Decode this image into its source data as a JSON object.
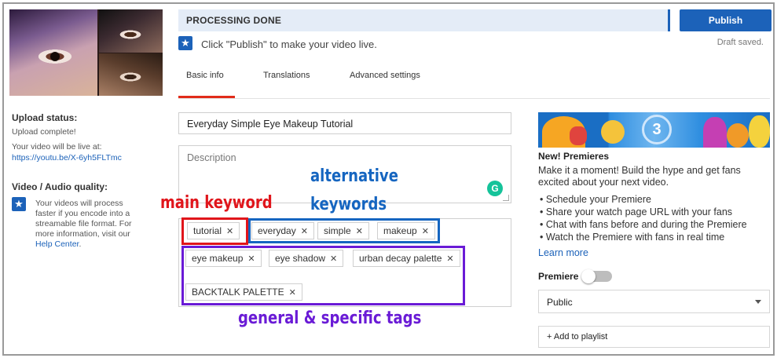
{
  "status": {
    "text": "PROCESSING DONE"
  },
  "header": {
    "publish_label": "Publish",
    "draft_text": "Draft saved.",
    "publish_hint": "Click \"Publish\" to make your video live."
  },
  "tabs": [
    {
      "label": "Basic info",
      "active": true
    },
    {
      "label": "Translations",
      "active": false
    },
    {
      "label": "Advanced settings",
      "active": false
    }
  ],
  "upload": {
    "heading": "Upload status:",
    "complete": "Upload complete!",
    "live_at": "Your video will be live at:",
    "url": "https://youtu.be/X-6yh5FLTmc"
  },
  "quality": {
    "heading": "Video / Audio quality:",
    "text": "Your videos will process faster if you encode into a streamable file format. For more information, visit our",
    "link": "Help Center",
    "end": "."
  },
  "form": {
    "title_value": "Everyday Simple Eye Makeup Tutorial",
    "description_placeholder": "Description"
  },
  "tags": [
    "tutorial",
    "everyday",
    "simple",
    "makeup",
    "eye makeup",
    "eye shadow",
    "urban decay palette",
    "BACKTALK PALETTE"
  ],
  "annotations": {
    "main": "main keyword",
    "alternative_line1": "alternative",
    "alternative_line2": "keywords",
    "general": "general & specific tags",
    "colors": {
      "main": "#e0151b",
      "alternative": "#1565c0",
      "general": "#6a1bd6"
    }
  },
  "premieres": {
    "banner_number": "3",
    "title": "New! Premieres",
    "text": "Make it a moment! Build the hype and get fans excited about your next video.",
    "bullets": [
      "Schedule your Premiere",
      "Share your watch page URL with your fans",
      "Chat with fans before and during the Premiere",
      "Watch the Premiere with fans in real time"
    ],
    "learn_more": "Learn more"
  },
  "premiere_toggle": {
    "label": "Premiere",
    "on": false
  },
  "visibility": {
    "selected": "Public"
  },
  "playlist": {
    "label": "+ Add to playlist"
  },
  "icons": {
    "star": "star-icon",
    "grammarly": "grammarly-icon",
    "remove": "close-icon",
    "caret": "caret-down-icon"
  },
  "colors": {
    "accent": "#1c62b9",
    "tab_active": "#e12b1a",
    "status_bg": "#e4ecf7"
  }
}
